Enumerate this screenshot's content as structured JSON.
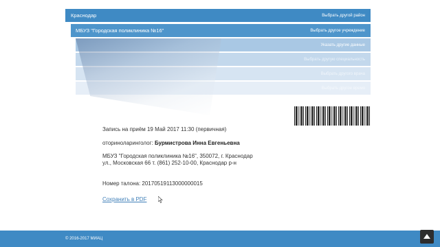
{
  "breadcrumb": {
    "region": {
      "label": "Краснодар",
      "action": "Выбрать другой район"
    },
    "institution": {
      "label": "МБУЗ \"Городская поликлиника №16\"",
      "action": "Выбрать другое учреждение"
    },
    "step3": {
      "action": "Указать другие данные"
    },
    "step4": {
      "action": "Выбрать другую специальность"
    },
    "step5": {
      "action": "Выбрать другого врача"
    },
    "step6": {
      "action": "Выбрать другое время"
    }
  },
  "ticket": {
    "record": "Запись на приём 19 Май 2017 11:30 (первичная)",
    "specialty": "оториноларинголог:",
    "doctor": "Бурмистрова Инна Евгеньевна",
    "address_line1": "МБУЗ \"Городская поликлиника №16\", 350072, г. Краснодар",
    "address_line2": "ул., Московская 66 т. (861) 252-10-00, Краснодар р-н",
    "number_label": "Номер талона:",
    "number_value": "20170519113000000015",
    "save_pdf": "Сохранить в PDF"
  },
  "footer": {
    "copyright": "© 2016-2017 МИАЦ"
  },
  "icons": {
    "scroll_up": "arrow-up-icon",
    "barcode": "barcode-icon",
    "cursor": "mouse-cursor-icon"
  },
  "colors": {
    "primary": "#3f8ac4",
    "link": "#3f7fb8"
  }
}
